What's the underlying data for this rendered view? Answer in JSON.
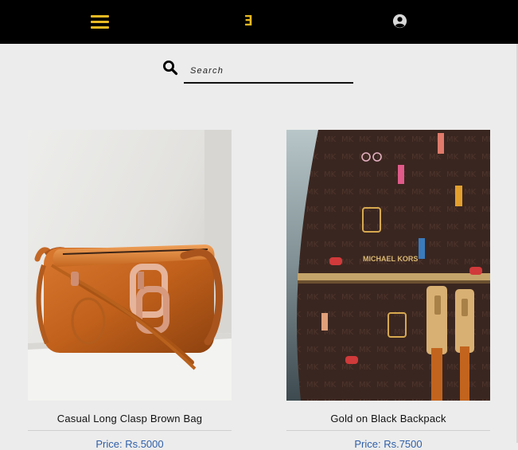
{
  "header": {
    "menu_icon": "hamburger-menu-icon",
    "logo_text": "Ǝ",
    "account_icon": "user-circle-icon",
    "accent_color": "#e8b923"
  },
  "search": {
    "icon": "search-icon",
    "placeholder": "Search",
    "value": ""
  },
  "products": [
    {
      "name": "Casual Long Clasp Brown Bag",
      "price": "Price: Rs.5000"
    },
    {
      "name": "Gold on Black Backpack",
      "price": "Price: Rs.7500"
    }
  ]
}
